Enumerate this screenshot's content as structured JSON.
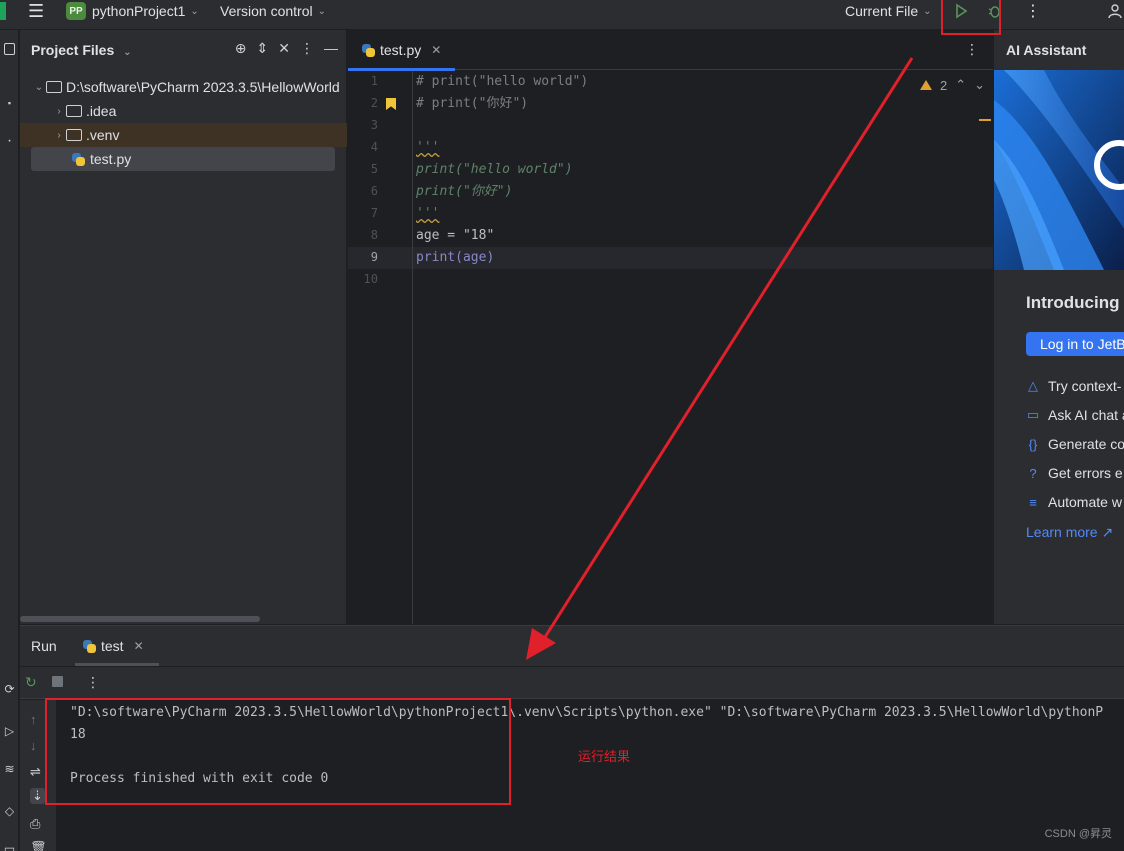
{
  "titlebar": {
    "project_badge": "PP",
    "project_name": "pythonProject1",
    "vcs_label": "Version control",
    "run_config": "Current File"
  },
  "project_panel": {
    "title": "Project Files",
    "tree": [
      {
        "label": "D:\\software\\PyCharm 2023.3.5\\HellowWorld",
        "type": "root"
      },
      {
        "label": ".idea",
        "type": "folder"
      },
      {
        "label": ".venv",
        "type": "folder"
      },
      {
        "label": "test.py",
        "type": "file"
      }
    ]
  },
  "editor": {
    "tab_label": "test.py",
    "warning_count": "2",
    "line_numbers": [
      "1",
      "2",
      "3",
      "4",
      "5",
      "6",
      "7",
      "8",
      "9",
      "10"
    ],
    "lines": [
      "# print(\"hello world\")",
      "# print(\"你好\")",
      "",
      "'''",
      "print(\"hello world\")",
      "print(\"你好\")",
      "'''",
      "age = \"18\"",
      "print(age)",
      ""
    ]
  },
  "ai_assistant": {
    "title": "AI Assistant",
    "heading": "Introducing",
    "login_button": "Log in to JetB",
    "items": [
      {
        "icon": "triangle-nodes-icon",
        "label": "Try context-"
      },
      {
        "icon": "chat-icon",
        "label": "Ask AI chat a"
      },
      {
        "icon": "braces-icon",
        "label": "Generate co"
      },
      {
        "icon": "question-icon",
        "label": "Get errors e"
      },
      {
        "icon": "list-icon",
        "label": "Automate w"
      }
    ],
    "learn_more": "Learn more ↗"
  },
  "run_panel": {
    "label": "Run",
    "tab_label": "test",
    "console": [
      "\"D:\\software\\PyCharm 2023.3.5\\HellowWorld\\pythonProject1\\.venv\\Scripts\\python.exe\" \"D:\\software\\PyCharm 2023.3.5\\HellowWorld\\pythonP",
      "18",
      "",
      "Process finished with exit code 0"
    ]
  },
  "annotation": {
    "result_label": "运行结果",
    "color": "#e0202a"
  },
  "watermark": "CSDN @昇灵"
}
